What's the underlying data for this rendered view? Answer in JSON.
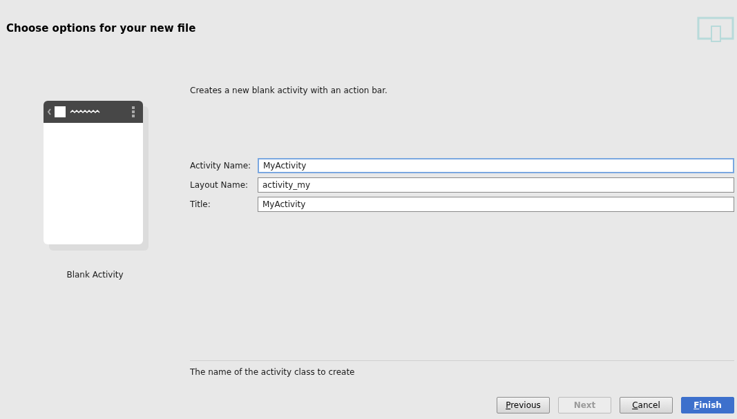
{
  "header": {
    "title": "Choose options for your new file"
  },
  "template": {
    "name": "Blank Activity"
  },
  "description": "Creates a new blank activity with an action bar.",
  "fields": [
    {
      "label": "Activity Name:",
      "value": "MyActivity",
      "focused": true
    },
    {
      "label": "Layout Name:",
      "value": "activity_my",
      "focused": false
    },
    {
      "label": "Title:",
      "value": "MyActivity",
      "focused": false
    }
  ],
  "hint": "The name of the activity class to create",
  "buttons": [
    {
      "label": "Previous",
      "kind": "default",
      "disabled": false
    },
    {
      "label": "Next",
      "kind": "default",
      "disabled": true
    },
    {
      "label": "Cancel",
      "kind": "default",
      "disabled": false
    },
    {
      "label": "Finish",
      "kind": "primary",
      "disabled": false
    }
  ]
}
